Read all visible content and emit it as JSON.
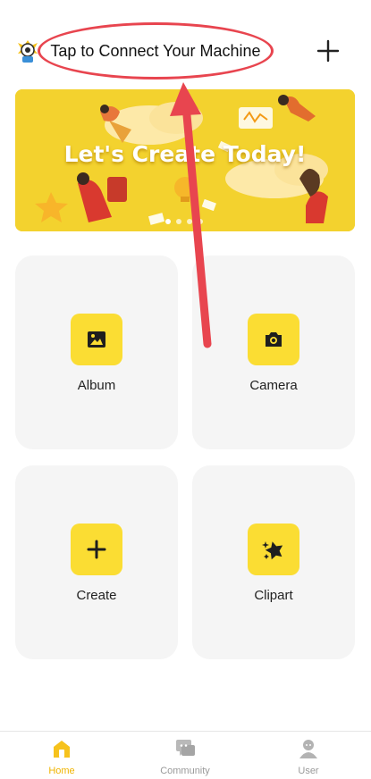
{
  "header": {
    "connect_label": "Tap to Connect Your Machine",
    "logo_icon": "mascot-logo-icon",
    "add_icon": "plus-icon"
  },
  "banner": {
    "title": "Let's Create Today!",
    "slide_count": 4,
    "active_slide": 1
  },
  "tiles": [
    {
      "label": "Album",
      "icon": "image-icon"
    },
    {
      "label": "Camera",
      "icon": "camera-icon"
    },
    {
      "label": "Create",
      "icon": "plus-icon"
    },
    {
      "label": "Clipart",
      "icon": "star-sparkle-icon"
    }
  ],
  "tabs": [
    {
      "label": "Home",
      "icon": "home-icon",
      "active": true
    },
    {
      "label": "Community",
      "icon": "chat-icon",
      "active": false
    },
    {
      "label": "User",
      "icon": "user-icon",
      "active": false
    }
  ],
  "colors": {
    "accent": "#fbdd33",
    "active_tab": "#f0b400",
    "annotation": "#e8454f",
    "tile_bg": "#f5f5f5"
  }
}
